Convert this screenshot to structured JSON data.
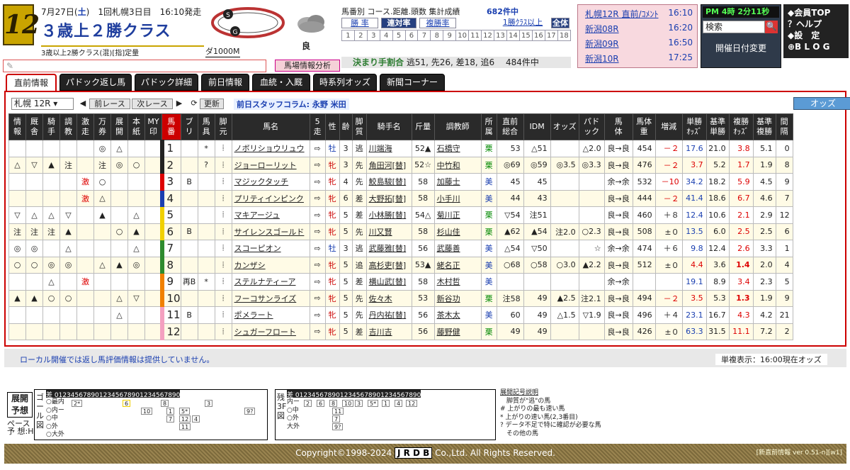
{
  "race": {
    "number": "12",
    "date": "7月27日(",
    "weekday": "土",
    "date_end": ")",
    "meeting": "1回札幌3日目",
    "post": "16:10発走",
    "name": "３歳上２勝クラス",
    "sub": "3歳以上2勝クラス(混)[指]定量",
    "distance": "ダ1000M",
    "baba": "良",
    "baba2": "良"
  },
  "memo_placeholder": "✎",
  "analysis_btn": "馬場情報分析",
  "stats": {
    "title": "馬番別 コース.距離.頭数 集計成績",
    "count": "682件中",
    "tabs": [
      "勝 率",
      "連対率",
      "複勝率"
    ],
    "class_link": "1勝ｸﾗｽ以上",
    "all_btn": "全体",
    "row1": [
      "1",
      "2",
      "3",
      "4",
      "5",
      "6",
      "7",
      "8",
      "9",
      "10",
      "11",
      "12",
      "13",
      "14",
      "15",
      "16",
      "17",
      "18"
    ],
    "kimari_label": "決まり手割合",
    "kimari_values": "逃51, 先26, 差18, 追6",
    "kimari_count": "484件中"
  },
  "race_list": [
    {
      "name": "札幌12R",
      "link": "直前/ｺﾒﾝﾄ",
      "time": "16:10"
    },
    {
      "name": "新潟08R",
      "link": "",
      "time": "16:20"
    },
    {
      "name": "新潟09R",
      "link": "",
      "time": "16:50"
    },
    {
      "name": "新潟10R",
      "link": "",
      "time": "17:25"
    }
  ],
  "clock": "PM 4時 2分11秒",
  "search_text": "検索",
  "date_change": "開催日付変更",
  "menu": [
    "◆会員TOP",
    "？ヘルプ",
    "◆設　定",
    "⊕B L O G"
  ],
  "tabs": [
    "直前情報",
    "パドック返し馬",
    "パドック詳細",
    "前日情報",
    "血統・入厩",
    "時系列オッズ",
    "新聞コーナー"
  ],
  "controls": {
    "race_select": "札幌 12R",
    "prev": "前レース",
    "next": "次レース",
    "refresh": "更新",
    "column": "前日スタッフコラム: 永野 米田",
    "odds": "オッズ"
  },
  "headers": [
    "情\n報",
    "厩\n舎",
    "騎\n手",
    "調\n教",
    "激\n走",
    "万\n券",
    "展\n開",
    "本\n紙",
    "MY\n印",
    "馬\n番",
    "ブ\nリ",
    "馬\n具",
    "脚\n元",
    "馬名",
    "5\n走",
    "性",
    "齢",
    "脚\n質",
    "騎手名",
    "斤量",
    "調教師",
    "所\n属",
    "直前\n総合",
    "IDM",
    "オッズ",
    "パド\nック",
    "馬\n体",
    "馬体\n重",
    "増減",
    "単勝\nｵｯｽﾞ",
    "基準\n単勝",
    "複勝\nｵｯｽﾞ",
    "基準\n複勝",
    "間\n隔"
  ],
  "horses": [
    [
      "",
      "",
      "",
      "",
      "",
      "◎",
      "△",
      "",
      "",
      "1",
      "",
      "*",
      "⦙",
      "ノボリショウリュウ",
      "⇨",
      "牡",
      "3",
      "逃",
      "川端海",
      "52▲",
      "石橋守",
      "栗",
      "53",
      "△51",
      "",
      "△2.0",
      "良→良",
      "454",
      "－２",
      "17.6",
      "21.0",
      "3.8",
      "5.1",
      "0"
    ],
    [
      "△",
      "▽",
      "▲",
      "注",
      "",
      "注",
      "◎",
      "○",
      "",
      "2",
      "",
      "?",
      "⦙",
      "ジョーローリット",
      "⇨",
      "牝",
      "3",
      "先",
      "角田河[替]",
      "52☆",
      "中竹和",
      "栗",
      "◎69",
      "◎59",
      "◎3.5",
      "◎3.3",
      "良→良",
      "476",
      "－２",
      "3.7",
      "5.2",
      "1.7",
      "1.9",
      "8"
    ],
    [
      "",
      "",
      "",
      "",
      "激",
      "○",
      "",
      "",
      "",
      "3",
      "B",
      "",
      "⦙",
      "マジックタッチ",
      "⇨",
      "牝",
      "4",
      "先",
      "鮫島駿[替]",
      "58",
      "加藤士",
      "美",
      "45",
      "45",
      "",
      "",
      "余→余",
      "532",
      "－10",
      "34.2",
      "18.2",
      "5.9",
      "4.5",
      "9"
    ],
    [
      "",
      "",
      "",
      "",
      "激",
      "△",
      "",
      "",
      "",
      "4",
      "",
      "",
      "⦙",
      "プリティインピンク",
      "⇨",
      "牝",
      "6",
      "差",
      "大野拓[替]",
      "58",
      "小手川",
      "美",
      "44",
      "43",
      "",
      "",
      "良→良",
      "444",
      "－２",
      "41.4",
      "18.6",
      "6.7",
      "4.6",
      "7"
    ],
    [
      "▽",
      "△",
      "△",
      "▽",
      "",
      "▲",
      "",
      "△",
      "",
      "5",
      "",
      "",
      "⦙",
      "マキアージュ",
      "⇨",
      "牝",
      "5",
      "差",
      "小林勝[替]",
      "54△",
      "菊川正",
      "栗",
      "▽54",
      "注51",
      "",
      "",
      "良→良",
      "460",
      "＋８",
      "12.4",
      "10.6",
      "2.1",
      "2.9",
      "12"
    ],
    [
      "注",
      "注",
      "注",
      "▲",
      "",
      "",
      "○",
      "▲",
      "",
      "6",
      "B",
      "",
      "⦙",
      "サイレンスゴールド",
      "⇨",
      "牝",
      "5",
      "先",
      "川又賢",
      "58",
      "杉山佳",
      "栗",
      "▲62",
      "▲54",
      "注2.0",
      "○2.3",
      "良→良",
      "508",
      "±０",
      "13.5",
      "6.0",
      "2.5",
      "2.5",
      "6"
    ],
    [
      "◎",
      "◎",
      "",
      "△",
      "",
      "",
      "",
      "△",
      "",
      "7",
      "",
      "",
      "⦙",
      "スコーピオン",
      "⇨",
      "牡",
      "3",
      "逃",
      "武藤雅[替]",
      "56",
      "武藤善",
      "美",
      "△54",
      "▽50",
      "",
      "☆",
      "余→余",
      "474",
      "＋６",
      "9.8",
      "12.4",
      "2.6",
      "3.3",
      "1"
    ],
    [
      "○",
      "○",
      "◎",
      "◎",
      "",
      "△",
      "▲",
      "◎",
      "",
      "8",
      "",
      "",
      "⦙",
      "カンザシ",
      "⇨",
      "牝",
      "5",
      "追",
      "高杉吏[替]",
      "53▲",
      "蛯名正",
      "美",
      "○68",
      "○58",
      "○3.0",
      "▲2.2",
      "良→良",
      "512",
      "±０",
      "4.4",
      "3.6",
      "1.4",
      "2.0",
      "4"
    ],
    [
      "",
      "",
      "△",
      "",
      "激",
      "",
      "",
      "",
      "",
      "9",
      "再B",
      "*",
      "⦙",
      "ステルナティーア",
      "⇨",
      "牝",
      "5",
      "差",
      "横山武[替]",
      "58",
      "木村哲",
      "美",
      "",
      "",
      "",
      "",
      "余→余",
      "",
      "",
      "19.1",
      "8.9",
      "3.4",
      "2.3",
      "5"
    ],
    [
      "▲",
      "▲",
      "○",
      "○",
      "",
      "",
      "△",
      "▽",
      "",
      "10",
      "",
      "",
      "⦙",
      "フーコサンライズ",
      "⇨",
      "牝",
      "5",
      "先",
      "佐々木",
      "53",
      "新谷功",
      "栗",
      "注58",
      "49",
      "▲2.5",
      "注2.1",
      "良→良",
      "494",
      "－２",
      "3.5",
      "5.3",
      "1.3",
      "1.9",
      "9"
    ],
    [
      "",
      "",
      "",
      "",
      "",
      "",
      "△",
      "",
      "",
      "11",
      "B",
      "",
      "⦙",
      "ポメラート",
      "⇨",
      "牝",
      "5",
      "先",
      "丹内祐[替]",
      "56",
      "茶木太",
      "美",
      "60",
      "49",
      "△1.5",
      "▽1.9",
      "良→良",
      "496",
      "＋４",
      "23.1",
      "16.7",
      "4.3",
      "4.2",
      "21"
    ],
    [
      "",
      "",
      "",
      "",
      "",
      "",
      "",
      "",
      "",
      "12",
      "",
      "",
      "⦙",
      "シュガーフロート",
      "⇨",
      "牝",
      "5",
      "差",
      "吉川吉",
      "56",
      "藤野健",
      "栗",
      "49",
      "49",
      "",
      "",
      "良→良",
      "426",
      "±０",
      "63.3",
      "31.5",
      "11.1",
      "7.2",
      "2"
    ]
  ],
  "waku_colors": [
    "#fff",
    "#222",
    "#d00",
    "#1a3fb0",
    "#f0d000",
    "#2e8b2e",
    "#f08000",
    "#f4a0c0"
  ],
  "note": "ローカル開催では返し馬評価情報は提供していません。",
  "odds_time": "単複表示：16:00現在オッズ",
  "pace": {
    "tenkai": "展開\n予想",
    "pace_label": "ペース\n予 想:H",
    "goal_label": "ゴール図",
    "f3_label": "残3F図",
    "scale": "差 0123456789012345678901234567890",
    "rows_goal": [
      "○最内",
      "○内ー",
      "○中",
      "○外",
      "○大外"
    ],
    "rows_3f": [
      "内ー",
      "○中",
      "○外",
      "大外"
    ],
    "legend_title": "展開記号説明",
    "legend": [
      "　脚質が\"逃\"の馬",
      "# 上がりの最も速い馬",
      "* 上がりの速い馬(2,3番目)",
      "? データ不足で特に確認が必要な馬",
      "　その他の馬"
    ]
  },
  "footer": {
    "copy": "Copyright©1998-2024 ",
    "jrdb": "J R D B",
    "rest": " Co.,Ltd. All Rights Reserved.",
    "ver": "[新直前情報 ver 0.51-n][w1]"
  }
}
